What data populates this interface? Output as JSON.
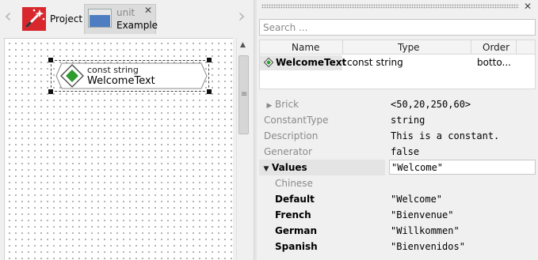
{
  "window": {
    "nav_back_glyph": "‹",
    "nav_forward_glyph": "›",
    "close_glyph": "✕"
  },
  "tabs": [
    {
      "label": "Project",
      "icon": "magic-wand-icon"
    },
    {
      "kind": "unit",
      "label": "Example",
      "icon": "unit-window-icon",
      "active": true
    }
  ],
  "canvas": {
    "node": {
      "type": "const string",
      "name": "WelcomeText",
      "icon": "constant-diamond-icon"
    }
  },
  "panel": {
    "search_placeholder": "Search ...",
    "columns": [
      "Name",
      "Type",
      "Order"
    ],
    "rows": [
      {
        "name": "WelcomeText",
        "type": "const string",
        "order": "botto..."
      }
    ],
    "properties": [
      {
        "name": "Brick",
        "value": "<50,20,250,60>",
        "expandable": true,
        "expanded": false
      },
      {
        "name": "ConstantType",
        "value": "string"
      },
      {
        "name": "Description",
        "value": "This is a constant."
      },
      {
        "name": "Generator",
        "value": "false"
      },
      {
        "name": "Values",
        "value": "\"Welcome\"",
        "expandable": true,
        "expanded": true,
        "editing": true
      },
      {
        "name": "Chinese",
        "value": ""
      },
      {
        "name": "Default",
        "value": "\"Welcome\""
      },
      {
        "name": "French",
        "value": "\"Bienvenue\""
      },
      {
        "name": "German",
        "value": "\"Willkommen\""
      },
      {
        "name": "Spanish",
        "value": "\"Bienvenidos\""
      }
    ]
  },
  "colors": {
    "project_icon": "#d8282e",
    "unit_icon": "#4f7dc1",
    "constant_icon": "#2e9b2e"
  }
}
